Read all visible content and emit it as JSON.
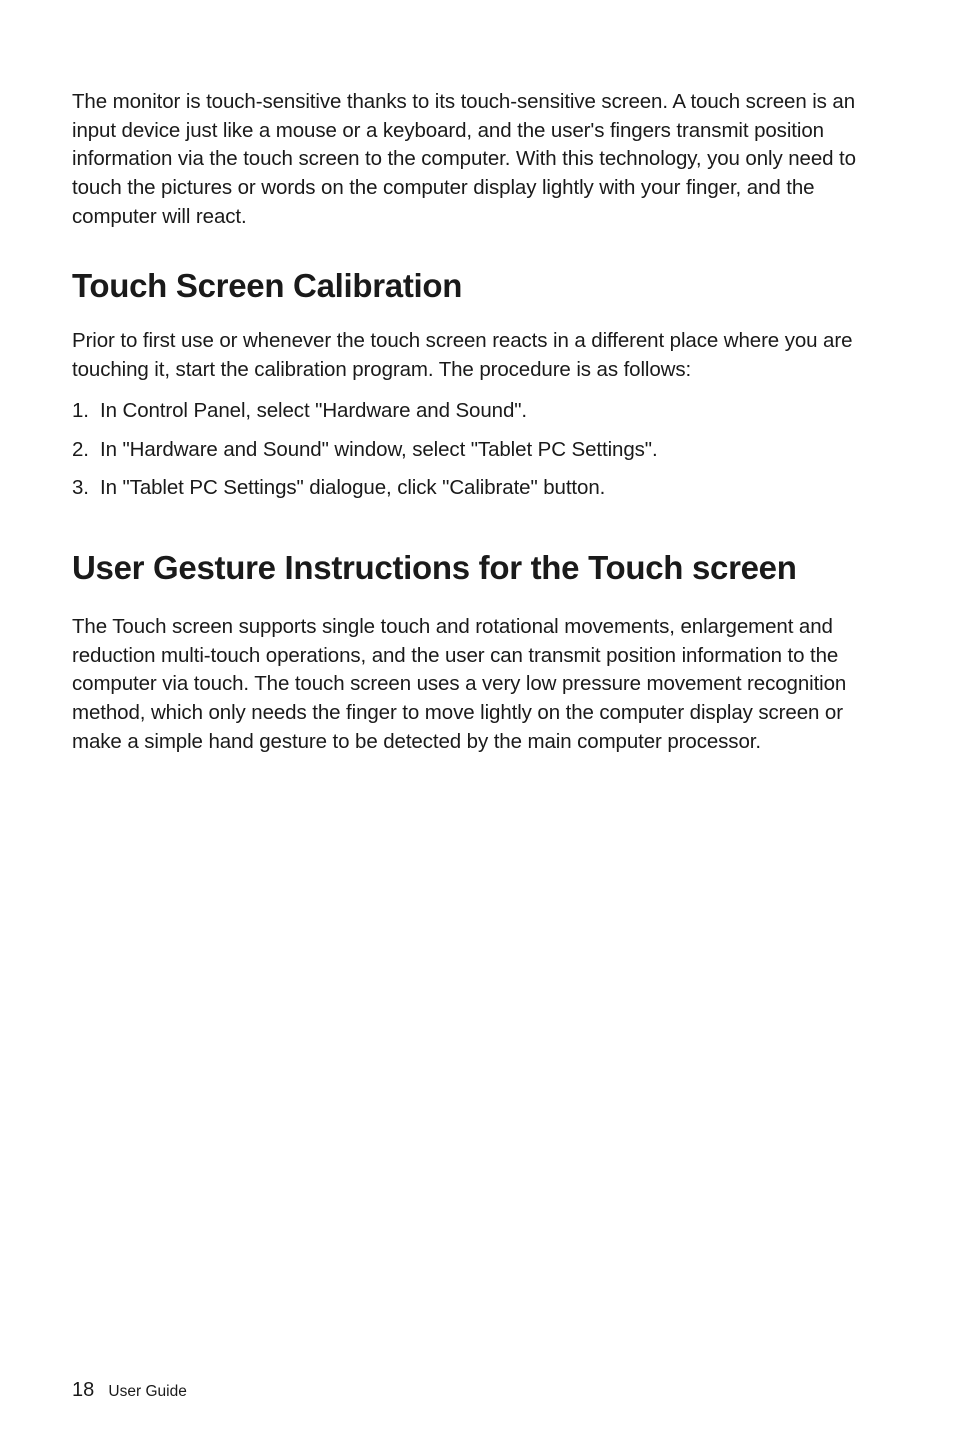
{
  "intro": "The monitor is touch-sensitive thanks to its touch-sensitive screen. A touch screen is an input device just like a mouse or a keyboard, and the user's fingers transmit position information via the touch screen to the computer. With this technology, you only need to touch the pictures or words on the computer display lightly with your finger, and the computer will react.",
  "section1": {
    "heading": "Touch Screen Calibration",
    "paragraph": "Prior to first use or whenever the touch screen reacts in a different place where you are touching it, start the calibration program. The procedure is as follows:",
    "list": [
      {
        "num": "1.",
        "text": "In Control Panel, select \"Hardware and Sound\"."
      },
      {
        "num": "2.",
        "text": "In \"Hardware and Sound\" window, select \"Tablet PC Settings\"."
      },
      {
        "num": "3.",
        "text": "In \"Tablet PC Settings\" dialogue, click \"Calibrate\" button."
      }
    ]
  },
  "section2": {
    "heading": "User Gesture Instructions for the Touch screen",
    "paragraph": "The Touch screen supports single touch and rotational movements, enlargement and reduction multi-touch operations, and the user can transmit position information to the computer via touch. The touch screen uses a very low pressure movement recognition method, which only needs the finger to move lightly on the computer display screen or make a simple hand gesture to be detected by the main computer processor."
  },
  "footer": {
    "page_number": "18",
    "doc_title": "User Guide"
  }
}
